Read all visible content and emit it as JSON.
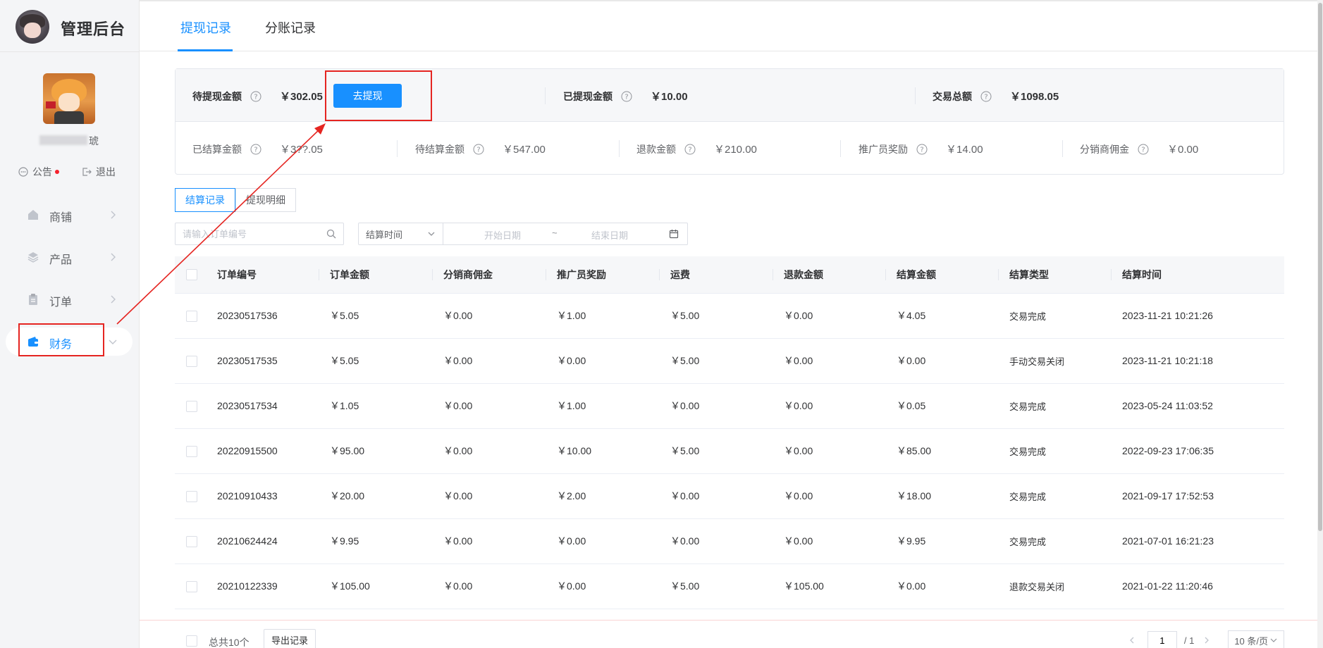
{
  "app": {
    "title": "管理后台"
  },
  "sidebar": {
    "shop_name_visible": "琥",
    "links": {
      "notice": "公告",
      "logout": "退出"
    },
    "menu": [
      {
        "label": "商铺",
        "icon": "shop-icon"
      },
      {
        "label": "产品",
        "icon": "layers-icon"
      },
      {
        "label": "订单",
        "icon": "clipboard-icon"
      },
      {
        "label": "财务",
        "icon": "wallet-icon",
        "active": true
      }
    ]
  },
  "tabs": [
    {
      "label": "提现记录",
      "active": true
    },
    {
      "label": "分账记录",
      "active": false
    }
  ],
  "summary": {
    "pending_withdraw": {
      "label": "待提现金额",
      "value": "￥302.05"
    },
    "withdraw_button": "去提现",
    "withdrawn": {
      "label": "已提现金额",
      "value": "￥10.00"
    },
    "total_trade": {
      "label": "交易总额",
      "value": "￥1098.05"
    },
    "settled": {
      "label": "已结算金额",
      "value": "￥3??.05"
    },
    "to_settle": {
      "label": "待结算金额",
      "value": "￥547.00"
    },
    "refund": {
      "label": "退款金额",
      "value": "￥210.00"
    },
    "promoter_reward": {
      "label": "推广员奖励",
      "value": "￥14.00"
    },
    "distributor_commission": {
      "label": "分销商佣金",
      "value": "￥0.00"
    }
  },
  "subtabs": {
    "settle_records": "结算记录",
    "withdraw_details": "提现明细"
  },
  "filters": {
    "search_placeholder": "请输入订单编号",
    "date_type": "结算时间",
    "start_placeholder": "开始日期",
    "separator": "~",
    "end_placeholder": "结束日期"
  },
  "table": {
    "columns": [
      "订单编号",
      "订单金额",
      "分销商佣金",
      "推广员奖励",
      "运费",
      "退款金额",
      "结算金额",
      "结算类型",
      "结算时间"
    ],
    "rows": [
      [
        "20230517536",
        "￥5.05",
        "￥0.00",
        "￥1.00",
        "￥5.00",
        "￥0.00",
        "￥4.05",
        "交易完成",
        "2023-11-21 10:21:26"
      ],
      [
        "20230517535",
        "￥5.05",
        "￥0.00",
        "￥0.00",
        "￥5.00",
        "￥0.00",
        "￥0.00",
        "手动交易关闭",
        "2023-11-21 10:21:18"
      ],
      [
        "20230517534",
        "￥1.05",
        "￥0.00",
        "￥1.00",
        "￥0.00",
        "￥0.00",
        "￥0.05",
        "交易完成",
        "2023-05-24 11:03:52"
      ],
      [
        "20220915500",
        "￥95.00",
        "￥0.00",
        "￥10.00",
        "￥5.00",
        "￥0.00",
        "￥85.00",
        "交易完成",
        "2022-09-23 17:06:35"
      ],
      [
        "20210910433",
        "￥20.00",
        "￥0.00",
        "￥2.00",
        "￥0.00",
        "￥0.00",
        "￥18.00",
        "交易完成",
        "2021-09-17 17:52:53"
      ],
      [
        "20210624424",
        "￥9.95",
        "￥0.00",
        "￥0.00",
        "￥0.00",
        "￥0.00",
        "￥9.95",
        "交易完成",
        "2021-07-01 16:21:23"
      ],
      [
        "20210122339",
        "￥105.00",
        "￥0.00",
        "￥0.00",
        "￥5.00",
        "￥105.00",
        "￥0.00",
        "退款交易关闭",
        "2021-01-22 11:20:46"
      ]
    ]
  },
  "footer": {
    "total": "总共10个",
    "export": "导出记录",
    "page": "1",
    "page_total": "/ 1",
    "page_size": "10 条/页"
  },
  "colors": {
    "accent": "#1890ff",
    "annotation": "#e52521"
  }
}
